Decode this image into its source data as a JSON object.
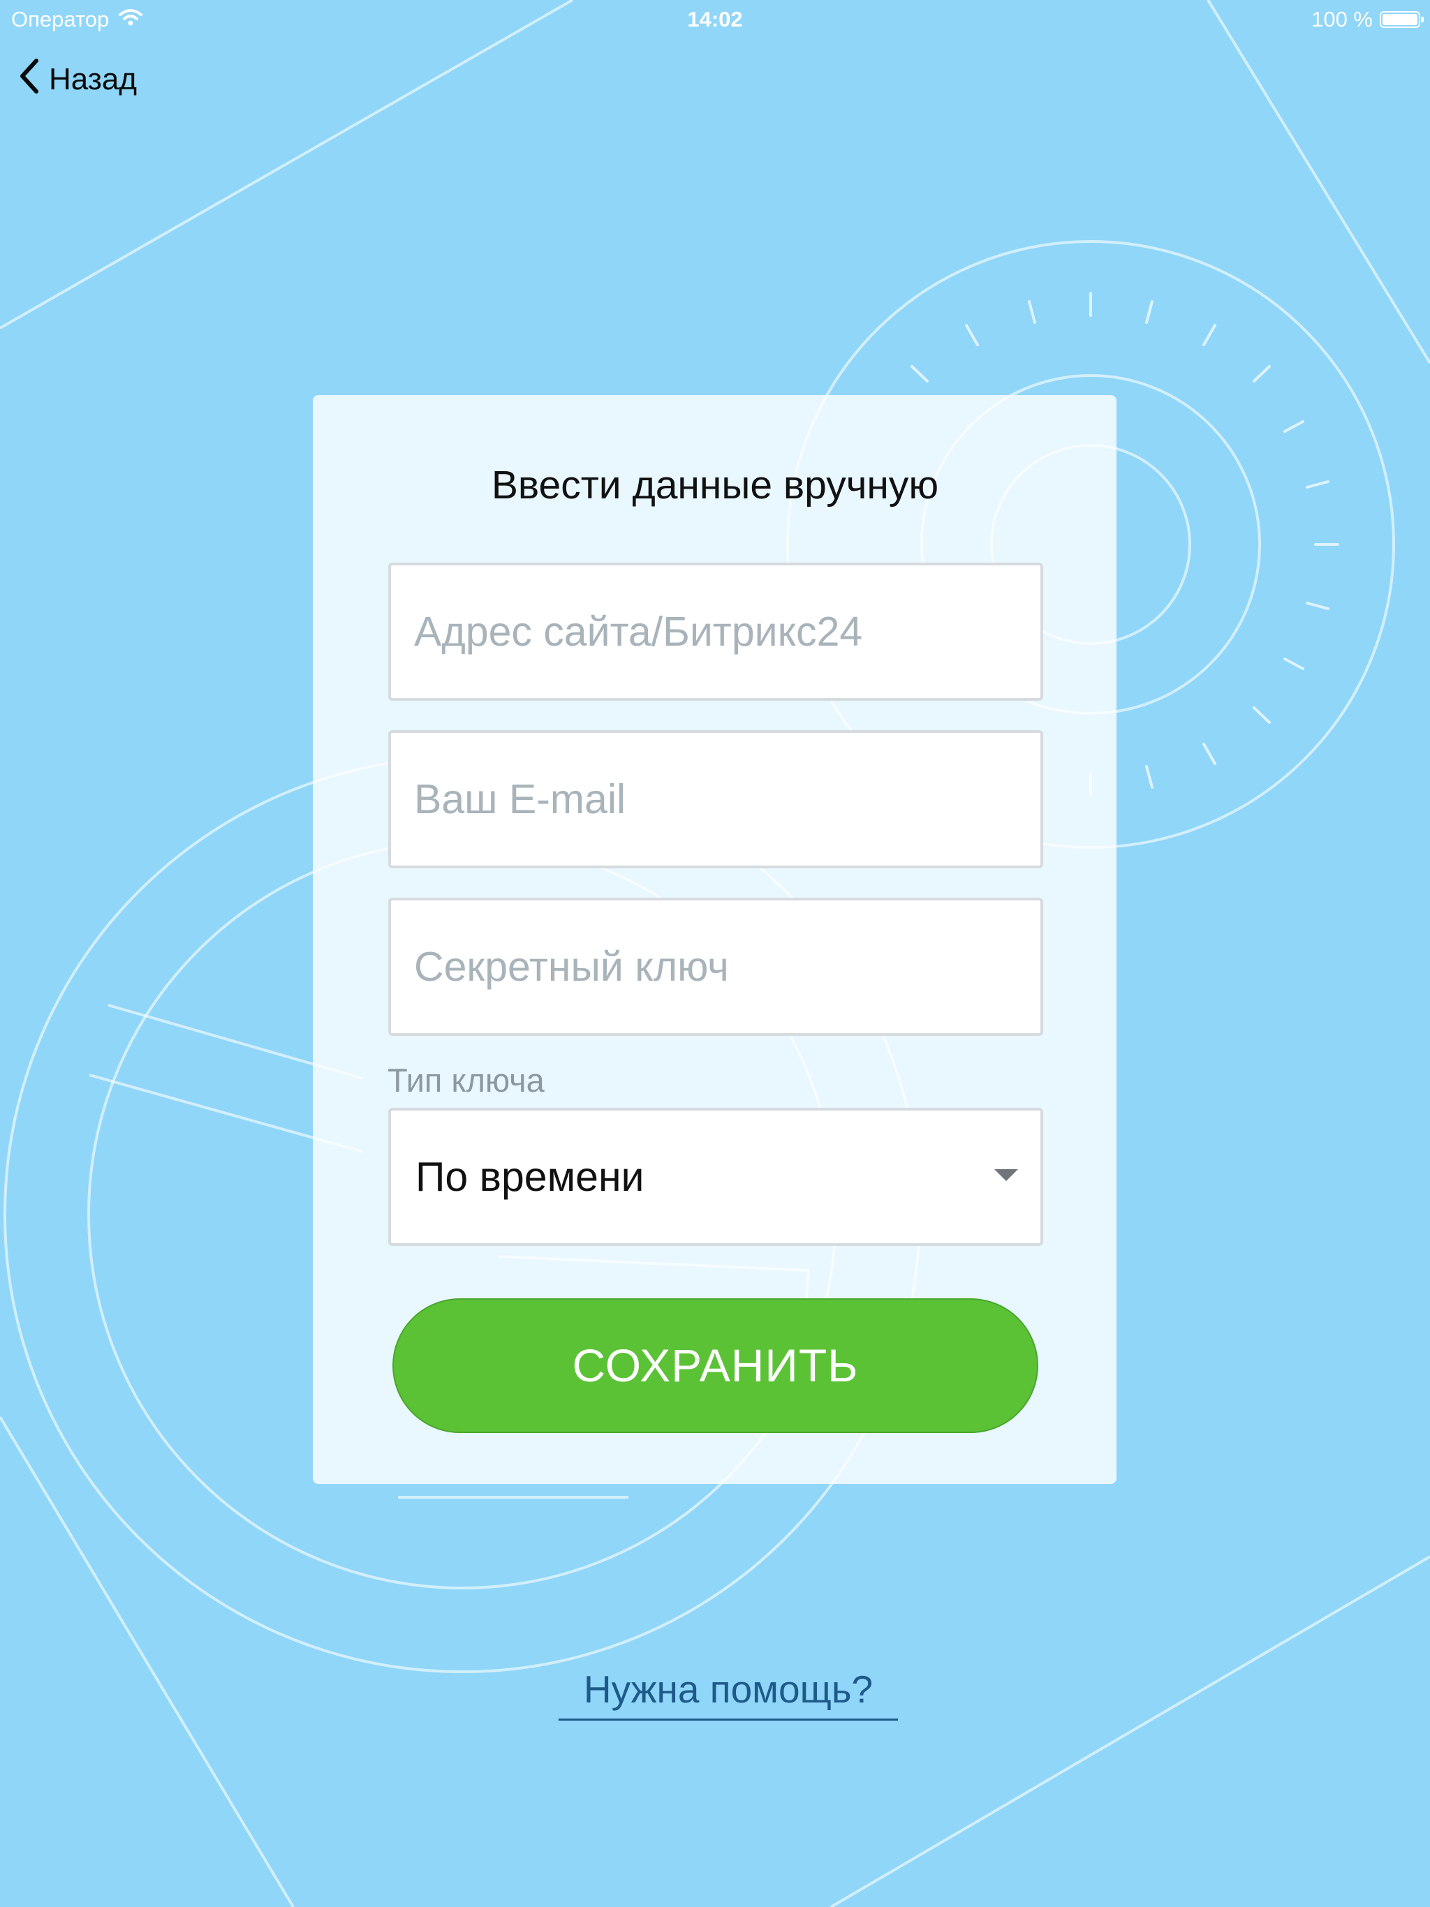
{
  "status_bar": {
    "carrier": "Оператор",
    "time": "14:02",
    "battery": "100 %",
    "wifi_icon": "wifi-icon",
    "battery_icon": "battery-icon"
  },
  "nav": {
    "back_label": "Назад",
    "back_icon": "chevron-left-icon"
  },
  "form": {
    "title": "Ввести данные вручную",
    "site_address": {
      "placeholder": "Адрес сайта/Битрикс24",
      "value": ""
    },
    "email": {
      "placeholder": "Ваш E-mail",
      "value": ""
    },
    "secret_key": {
      "placeholder": "Секретный ключ",
      "value": ""
    },
    "key_type_label": "Тип ключа",
    "key_type_value": "По времени",
    "save_label": "СОХРАНИТЬ"
  },
  "help_link": "Нужна помощь?",
  "colors": {
    "background": "#90d6f8",
    "save_button": "#5bc236",
    "link": "#1d5a8a",
    "placeholder": "#a8b3ba"
  }
}
